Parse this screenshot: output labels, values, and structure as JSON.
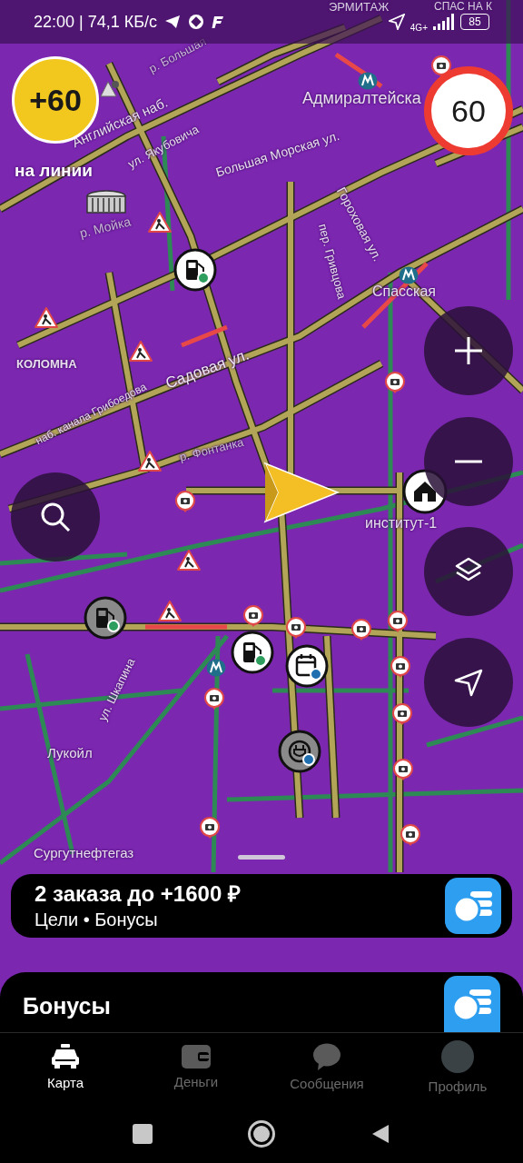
{
  "status_bar": {
    "text": "22:00 | 74,1 КБ/с",
    "network": "4G+",
    "battery": "85"
  },
  "bonus": {
    "points": "+60",
    "status": "на линии"
  },
  "speed_limit": "60",
  "map_labels": [
    {
      "text": "ЭРМИТАЖ"
    },
    {
      "text": "СПАС НА К"
    },
    {
      "text": "Адмиралтейска"
    },
    {
      "text": "Английская наб."
    },
    {
      "text": "р. Большая"
    },
    {
      "text": "ул. Якубовича"
    },
    {
      "text": "Большая Морская ул."
    },
    {
      "text": "Гороховая ул."
    },
    {
      "text": "пер. Гривцова"
    },
    {
      "text": "р. Мойка"
    },
    {
      "text": "Спасская"
    },
    {
      "text": "КОЛОМНА"
    },
    {
      "text": "наб. канала Грибоедова"
    },
    {
      "text": "Садовая ул."
    },
    {
      "text": "р. Фонтанка"
    },
    {
      "text": "институт-1"
    },
    {
      "text": "ул. Шкапина"
    },
    {
      "text": "Лукойл"
    },
    {
      "text": "Сургутнефтегаз"
    }
  ],
  "goal_card": {
    "title": "2 заказа до +1600 ₽",
    "subtitle": "Цели • Бонусы"
  },
  "sheet": {
    "title": "Бонусы"
  },
  "tabs": [
    {
      "label": "Карта",
      "selected": true
    },
    {
      "label": "Деньги",
      "selected": false
    },
    {
      "label": "Сообщения",
      "selected": false
    },
    {
      "label": "Профиль",
      "selected": false
    }
  ]
}
